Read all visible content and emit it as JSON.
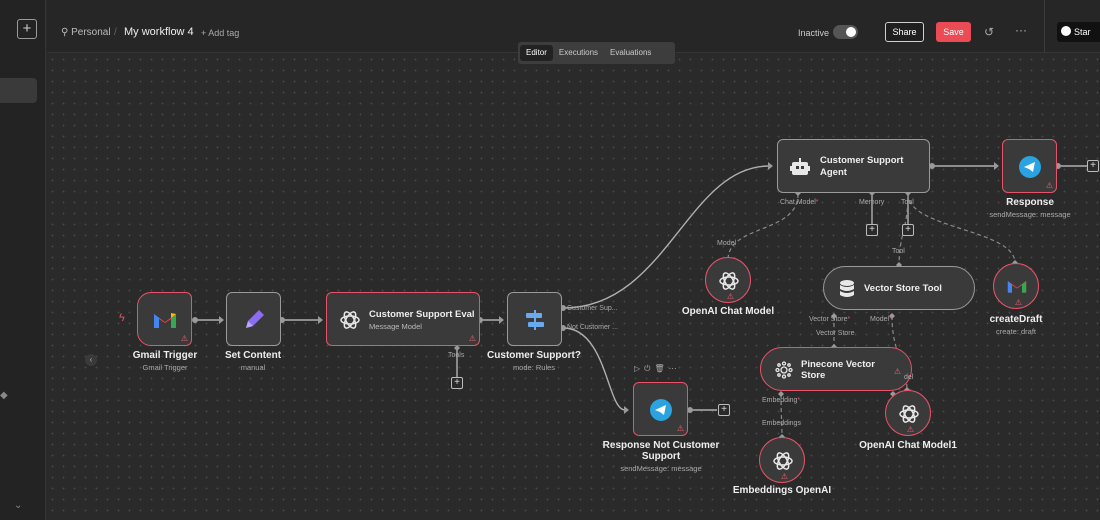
{
  "header": {
    "project": "Personal",
    "workflow_title": "My workflow 4",
    "add_tag": "+ Add tag",
    "status_label": "Inactive",
    "share_label": "Share",
    "save_label": "Save",
    "github_label": "Star"
  },
  "tabs": [
    "Editor",
    "Executions",
    "Evaluations"
  ],
  "nodes": {
    "gmail_trigger": {
      "label": "Gmail Trigger",
      "sub": "Gmail Trigger"
    },
    "set_content": {
      "label": "Set Content",
      "sub": "manual"
    },
    "eval": {
      "label": "Customer Support Eval",
      "sub": "Message Model",
      "port": "Tools"
    },
    "switch": {
      "label": "Customer Support?",
      "sub": "mode: Rules",
      "out1": "Customer Sup...",
      "out2": "Not Customer ..."
    },
    "agent": {
      "label_1": "Customer Support",
      "label_2": "Agent",
      "port_chat": "Chat Model",
      "port_memory": "Memory",
      "port_tool": "Tool"
    },
    "response": {
      "label": "Response",
      "sub": "sendMessage: message"
    },
    "response_not": {
      "label_1": "Response Not Customer",
      "label_2": "Support",
      "sub": "sendMessage: message"
    },
    "openai_chat": {
      "label": "OpenAI Chat Model",
      "port": "Model"
    },
    "vector_tool": {
      "label": "Vector Store Tool",
      "port_top": "Tool",
      "port_store": "Vector Store",
      "port_model": "Model"
    },
    "create_draft": {
      "label": "createDraft",
      "sub": "create: draft"
    },
    "pinecone": {
      "label_1": "Pinecone Vector",
      "label_2": "Store",
      "port_embed": "Embedding",
      "port_side": "del"
    },
    "openai_chat1": {
      "label": "OpenAI Chat Model1"
    },
    "embeddings": {
      "label": "Embeddings OpenAI",
      "port": "Embeddings"
    }
  },
  "colors": {
    "accent": "#ea4b55",
    "error_border": "#e8536a",
    "node_bg": "#3a3a3a",
    "canvas_bg": "#2a2a2a",
    "telegram": "#2aa3e0"
  }
}
